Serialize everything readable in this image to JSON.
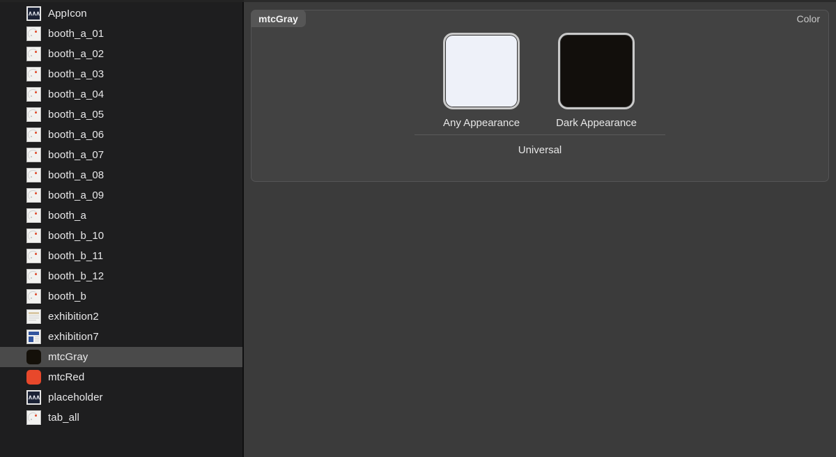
{
  "window": {
    "background": "#1e1e1e",
    "sidebar_background": "#1e1e1f",
    "content_background": "#3b3b3b"
  },
  "sidebar": {
    "items": [
      {
        "label": "AppIcon",
        "icon": "appicon-thumbnail-icon",
        "selected": false
      },
      {
        "label": "booth_a_01",
        "icon": "image-thumbnail-icon",
        "selected": false
      },
      {
        "label": "booth_a_02",
        "icon": "image-thumbnail-icon",
        "selected": false
      },
      {
        "label": "booth_a_03",
        "icon": "image-thumbnail-icon",
        "selected": false
      },
      {
        "label": "booth_a_04",
        "icon": "image-thumbnail-icon",
        "selected": false
      },
      {
        "label": "booth_a_05",
        "icon": "image-thumbnail-icon",
        "selected": false
      },
      {
        "label": "booth_a_06",
        "icon": "image-thumbnail-icon",
        "selected": false
      },
      {
        "label": "booth_a_07",
        "icon": "image-thumbnail-icon",
        "selected": false
      },
      {
        "label": "booth_a_08",
        "icon": "image-thumbnail-icon",
        "selected": false
      },
      {
        "label": "booth_a_09",
        "icon": "image-thumbnail-icon",
        "selected": false
      },
      {
        "label": "booth_a",
        "icon": "image-thumbnail-icon",
        "selected": false
      },
      {
        "label": "booth_b_10",
        "icon": "image-thumbnail-icon",
        "selected": false
      },
      {
        "label": "booth_b_11",
        "icon": "image-thumbnail-icon",
        "selected": false
      },
      {
        "label": "booth_b_12",
        "icon": "image-thumbnail-icon",
        "selected": false
      },
      {
        "label": "booth_b",
        "icon": "image-thumbnail-icon",
        "selected": false
      },
      {
        "label": "exhibition2",
        "icon": "document-thumbnail-icon",
        "selected": false
      },
      {
        "label": "exhibition7",
        "icon": "document-blue-thumbnail-icon",
        "selected": false
      },
      {
        "label": "mtcGray",
        "icon": "color-swatch-icon",
        "selected": true,
        "swatch_color": "#141009"
      },
      {
        "label": "mtcRed",
        "icon": "color-swatch-icon",
        "selected": false,
        "swatch_color": "#e8482b"
      },
      {
        "label": "placeholder",
        "icon": "appicon-thumbnail-icon",
        "selected": false
      },
      {
        "label": "tab_all",
        "icon": "image-thumbnail-icon",
        "selected": false
      }
    ],
    "selection_color": "#4a4a4a"
  },
  "editor": {
    "tab_label": "mtcGray",
    "kind_label": "Color",
    "appearances": [
      {
        "label": "Any Appearance",
        "color": "#eef1f9"
      },
      {
        "label": "Dark Appearance",
        "color": "#120f0c"
      }
    ],
    "group_label": "Universal",
    "swatch_border_color": "#c9c9c9"
  }
}
